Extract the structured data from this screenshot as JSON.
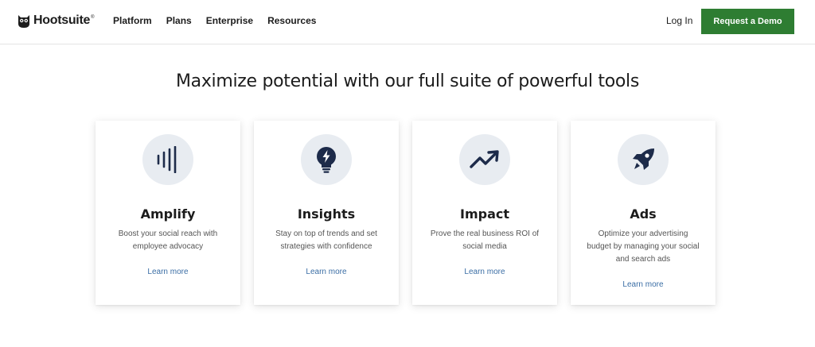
{
  "header": {
    "logo_text": "Hootsuite",
    "logo_reg": "®",
    "nav": [
      "Platform",
      "Plans",
      "Enterprise",
      "Resources"
    ],
    "login_label": "Log In",
    "demo_label": "Request a Demo",
    "accent_color": "#2e7d32"
  },
  "main": {
    "headline": "Maximize potential with our full suite of powerful tools",
    "cards": [
      {
        "icon": "soundwave-icon",
        "title": "Amplify",
        "description": "Boost your social reach with employee advocacy",
        "link": "Learn more"
      },
      {
        "icon": "lightbulb-bolt-icon",
        "title": "Insights",
        "description": "Stay on top of trends and set strategies with confidence",
        "link": "Learn more"
      },
      {
        "icon": "trending-up-icon",
        "title": "Impact",
        "description": "Prove the real business ROI of social media",
        "link": "Learn more"
      },
      {
        "icon": "rocket-icon",
        "title": "Ads",
        "description": "Optimize your advertising budget by managing your social and search ads",
        "link": "Learn more"
      }
    ]
  }
}
